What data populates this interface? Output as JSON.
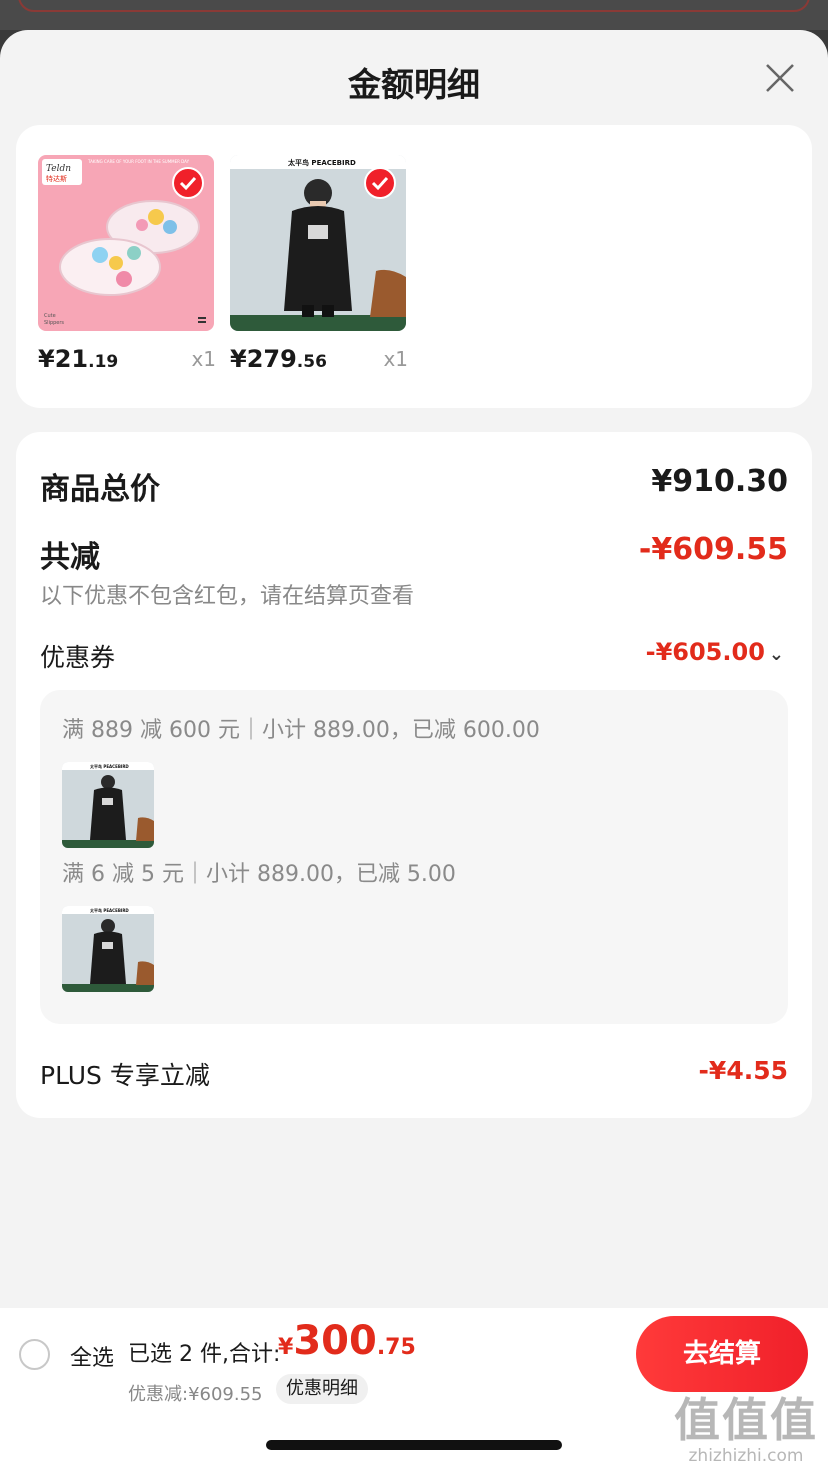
{
  "header": {
    "title": "金额明细"
  },
  "products": [
    {
      "price_int": "¥21",
      "price_dec": ".19",
      "qty": "x1",
      "brand": "Teldn 特达斯",
      "tagline": "TAKING CARE OF YOUR FOOT IN THE SUMMER DAY",
      "caption": "Cute Slippers"
    },
    {
      "price_int": "¥279",
      "price_dec": ".56",
      "qty": "x1",
      "brand": "太平鸟 PEACEBIRD"
    }
  ],
  "summary": {
    "total_label": "商品总价",
    "total_value": "¥910.30",
    "reduce_label": "共减",
    "reduce_value": "-¥609.55",
    "note": "以下优惠不包含红包，请在结算页查看",
    "coupon_label": "优惠券",
    "coupon_value": "-¥605.00",
    "coupon_lines": [
      "满 889 减 600 元｜小计 889.00，已减 600.00",
      "满 6 减 5 元｜小计 889.00，已减 5.00"
    ],
    "plus_label": "PLUS 专享立减",
    "plus_value": "-¥4.55"
  },
  "bottom": {
    "select_all": "全选",
    "selected_text": "已选 2 件,合计:",
    "total_currency": "¥",
    "total_int": "300",
    "total_dec": ".75",
    "discount_text": "优惠减:¥609.55",
    "detail_button": "优惠明细",
    "checkout_button": "去结算"
  },
  "watermark": {
    "main": "值值值",
    "sub": "zhizhizhi.com"
  },
  "colors": {
    "accent": "#e22b1b",
    "checkout": "#f0202a",
    "sheet_bg": "#f3f3f3"
  }
}
